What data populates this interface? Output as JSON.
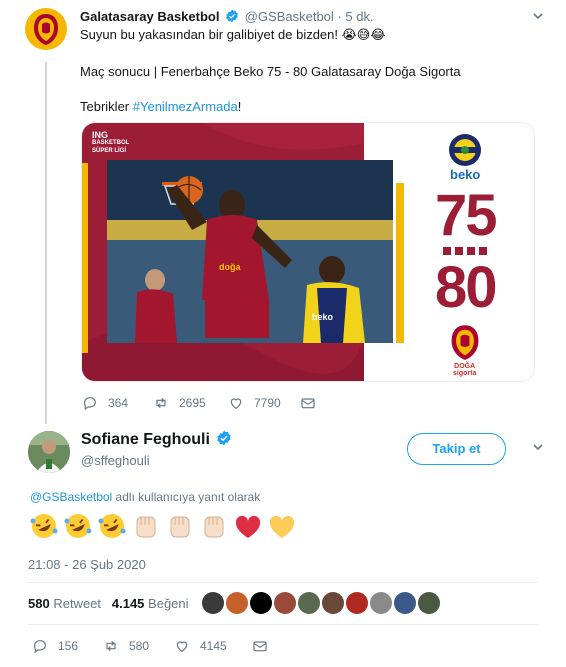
{
  "parent_tweet": {
    "display_name": "Galatasaray Basketbol",
    "handle": "@GSBasketbol",
    "separator": "·",
    "time": "5 dk.",
    "line1": "Suyun bu yakasından bir galibiyet de bizden! 😭😅😂",
    "line2": "Maç sonucu | Fenerbahçe Beko 75 - 80 Galatasaray Doğa Sigorta",
    "line3_prefix": "Tebrikler ",
    "line3_hashtag": "#YenilmezArmada",
    "line3_suffix": "!",
    "media": {
      "league_line1": "ING",
      "league_line2": "BASKETBOL",
      "league_line3": "SÜPER LİGİ",
      "home_score": "75",
      "away_score": "80",
      "home_sponsor": "beko",
      "away_sponsor_line1": "DOĞA",
      "away_sponsor_line2": "sigorta",
      "accent_color": "#9b1d36",
      "stripe_color": "#f3b700"
    },
    "counts": {
      "replies": "364",
      "retweets": "2695",
      "likes": "7790"
    }
  },
  "reply_tweet": {
    "display_name": "Sofiane Feghouli",
    "handle": "@sffeghouli",
    "follow_label": "Takip et",
    "reply_to_mention": "@GSBasketbol",
    "reply_to_suffix": " adlı kullanıcıya yanıt olarak",
    "emojis": [
      "rofl",
      "rofl",
      "rofl",
      "fist-light",
      "fist-light",
      "fist-light",
      "red-heart",
      "yellow-heart"
    ],
    "timestamp": "21:08 - 26 Şub 2020",
    "retweet_count": "580",
    "retweet_label": "Retweet",
    "like_count": "4.145",
    "like_label": "Beğeni",
    "counts": {
      "replies": "156",
      "retweets": "580",
      "likes": "4145"
    }
  },
  "colors": {
    "link": "#1b95e0",
    "follow": "#1da1f2",
    "muted": "#657786"
  }
}
